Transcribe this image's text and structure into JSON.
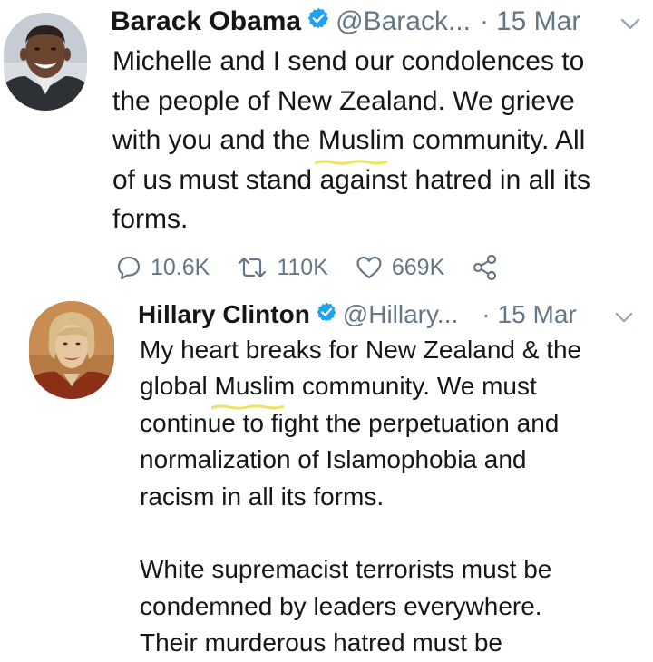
{
  "colors": {
    "verified": "#1da1f2",
    "secondary_text": "#657786",
    "highlight": "#f0e36a"
  },
  "tweets": [
    {
      "author": {
        "name": "Barack Obama",
        "handle": "@Barack...",
        "verified": true
      },
      "separator": "·",
      "date": "15 Mar",
      "text_lines": [
        [
          "Michelle and I send our condolences to"
        ],
        [
          "the people of New Zealand. We grieve"
        ],
        [
          "with you and the ",
          "Muslim",
          " community. All"
        ],
        [
          "of us must stand against hatred in all its"
        ],
        [
          "forms."
        ]
      ],
      "actions": {
        "replies": {
          "icon": "reply-icon",
          "count": "10.6K"
        },
        "retweets": {
          "icon": "retweet-icon",
          "count": "110K"
        },
        "likes": {
          "icon": "heart-icon",
          "count": "669K"
        },
        "share": {
          "icon": "share-icon"
        }
      }
    },
    {
      "author": {
        "name": "Hillary Clinton",
        "handle": "@Hillary...",
        "verified": true
      },
      "separator": "·",
      "date": "15 Mar",
      "text_lines": [
        [
          "My heart breaks for New Zealand & the"
        ],
        [
          "global ",
          "Muslim",
          " community. We must"
        ],
        [
          "continue to fight the perpetuation and"
        ],
        [
          "normalization of Islamophobia and"
        ],
        [
          "racism in all its forms."
        ],
        [
          ""
        ],
        [
          "White supremacist terrorists must be"
        ],
        [
          "condemned by leaders everywhere."
        ],
        [
          "Their murderous hatred must be"
        ]
      ]
    }
  ]
}
